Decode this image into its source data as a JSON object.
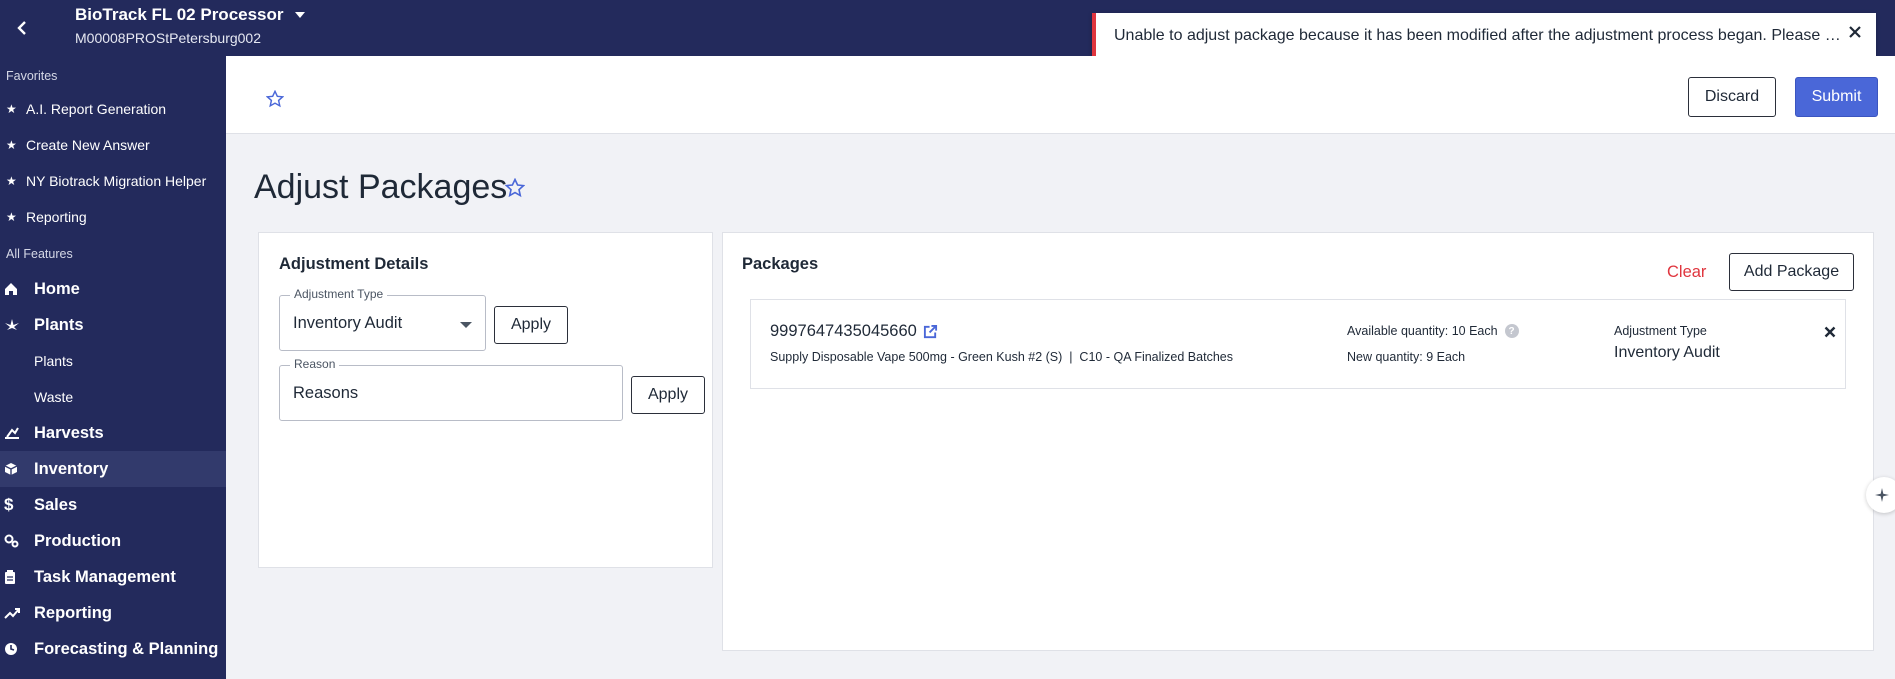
{
  "header": {
    "facility_name": "BioTrack FL 02 Processor",
    "license": "M00008PROStPetersburg002"
  },
  "toast": {
    "message": "Unable to adjust package because it has been modified after the adjustment process began. Please try a..."
  },
  "sidebar": {
    "favorites_title": "Favorites",
    "favorites": [
      {
        "label": "A.I. Report Generation"
      },
      {
        "label": "Create New Answer"
      },
      {
        "label": "NY Biotrack Migration Helper"
      },
      {
        "label": "Reporting"
      }
    ],
    "features_title": "All Features",
    "items": [
      {
        "label": "Home",
        "icon": "home-icon"
      },
      {
        "label": "Plants",
        "icon": "leaf-icon"
      },
      {
        "label": "Plants",
        "sub": true
      },
      {
        "label": "Waste",
        "sub": true
      },
      {
        "label": "Harvests",
        "icon": "harvest-icon"
      },
      {
        "label": "Inventory",
        "icon": "box-icon",
        "active": true
      },
      {
        "label": "Sales",
        "icon": "dollar-icon"
      },
      {
        "label": "Production",
        "icon": "production-icon"
      },
      {
        "label": "Task Management",
        "icon": "clipboard-icon"
      },
      {
        "label": "Reporting",
        "icon": "chart-icon"
      },
      {
        "label": "Forecasting & Planning",
        "icon": "clock-icon"
      }
    ]
  },
  "toolbar": {
    "discard_label": "Discard",
    "submit_label": "Submit"
  },
  "page": {
    "title": "Adjust Packages"
  },
  "adjustment_details": {
    "title": "Adjustment Details",
    "type_label": "Adjustment Type",
    "type_value": "Inventory Audit",
    "type_apply": "Apply",
    "reason_label": "Reason",
    "reason_value": "Reasons",
    "reason_apply": "Apply"
  },
  "packages": {
    "title": "Packages",
    "clear_label": "Clear",
    "add_label": "Add Package",
    "items": [
      {
        "id": "9997647435045660",
        "description": "Supply Disposable Vape 500mg - Green Kush #2 (S)  |  C10 - QA Finalized Batches",
        "available_qty": "Available quantity: 10 Each",
        "new_qty": "New quantity: 9 Each",
        "adj_type_label": "Adjustment Type",
        "adj_type_value": "Inventory Audit"
      }
    ]
  },
  "colors": {
    "nav_bg": "#232a5c",
    "primary": "#4a67d8",
    "danger": "#e0353e"
  }
}
